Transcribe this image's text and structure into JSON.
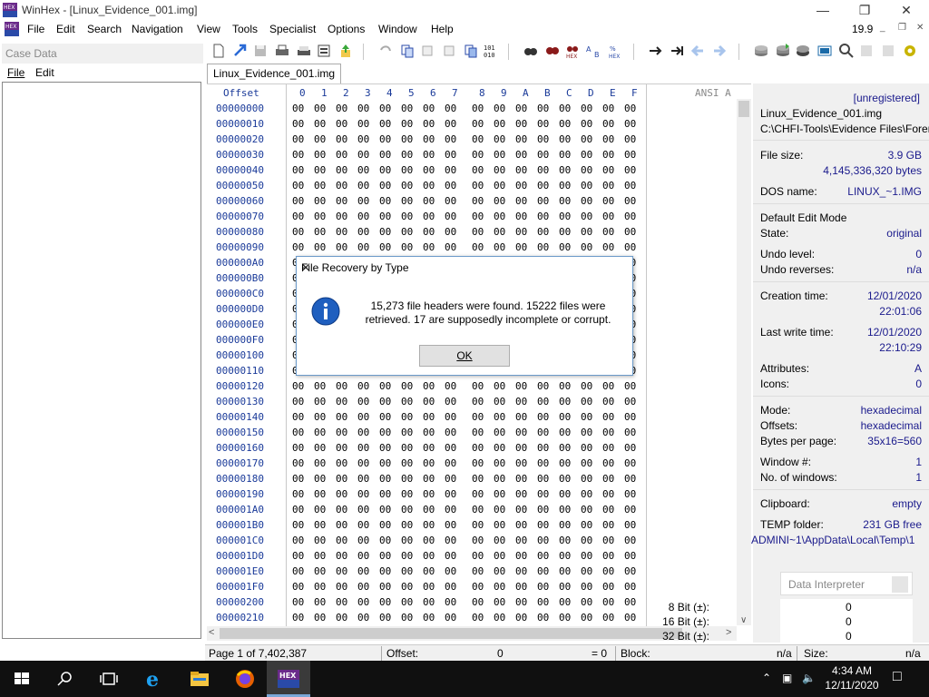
{
  "window": {
    "title": "WinHex - [Linux_Evidence_001.img]",
    "version": "19.9"
  },
  "menu": [
    "File",
    "Edit",
    "Search",
    "Navigation",
    "View",
    "Tools",
    "Specialist",
    "Options",
    "Window",
    "Help"
  ],
  "case_pane": {
    "header": "Case Data",
    "menu_file": "File",
    "menu_edit": "Edit"
  },
  "tab": {
    "label": "Linux_Evidence_001.img"
  },
  "hex": {
    "offset_header": "Offset",
    "column_headers": [
      "0",
      "1",
      "2",
      "3",
      "4",
      "5",
      "6",
      "7",
      "8",
      "9",
      "A",
      "B",
      "C",
      "D",
      "E",
      "F"
    ],
    "ansi_header": "ANSI A",
    "byte_value": "00",
    "offsets": [
      "00000000",
      "00000010",
      "00000020",
      "00000030",
      "00000040",
      "00000050",
      "00000060",
      "00000070",
      "00000080",
      "00000090",
      "000000A0",
      "000000B0",
      "000000C0",
      "000000D0",
      "000000E0",
      "000000F0",
      "00000100",
      "00000110",
      "00000120",
      "00000130",
      "00000140",
      "00000150",
      "00000160",
      "00000170",
      "00000180",
      "00000190",
      "000001A0",
      "000001B0",
      "000001C0",
      "000001D0",
      "000001E0",
      "000001F0",
      "00000200",
      "00000210"
    ]
  },
  "info": {
    "unregistered": "[unregistered]",
    "filename": "Linux_Evidence_001.img",
    "path": "C:\\CHFI-Tools\\Evidence Files\\Forer",
    "file_size_label": "File size:",
    "file_size": "3.9 GB",
    "file_size_bytes": "4,145,336,320 bytes",
    "dos_name_label": "DOS name:",
    "dos_name": "LINUX_~1.IMG",
    "edit_mode": "Default Edit Mode",
    "state_label": "State:",
    "state": "original",
    "undo_level_label": "Undo level:",
    "undo_level": "0",
    "undo_reverses_label": "Undo reverses:",
    "undo_reverses": "n/a",
    "creation_label": "Creation time:",
    "creation_date": "12/01/2020",
    "creation_time": "22:01:06",
    "lastwrite_label": "Last write time:",
    "lastwrite_date": "12/01/2020",
    "lastwrite_time": "22:10:29",
    "attributes_label": "Attributes:",
    "attributes": "A",
    "icons_label": "Icons:",
    "icons": "0",
    "mode_label": "Mode:",
    "mode": "hexadecimal",
    "offsets_label": "Offsets:",
    "offsets": "hexadecimal",
    "bpp_label": "Bytes per page:",
    "bpp": "35x16=560",
    "window_no_label": "Window #:",
    "window_no": "1",
    "num_windows_label": "No. of windows:",
    "num_windows": "1",
    "clipboard_label": "Clipboard:",
    "clipboard": "empty",
    "temp_label": "TEMP folder:",
    "temp_free": "231 GB free",
    "temp_path": "ADMINI~1\\AppData\\Local\\Temp\\1",
    "data_interpreter": "Data Interpreter",
    "di_8": "8 Bit (±):",
    "di_8_val": "0",
    "di_16": "16 Bit (±):",
    "di_16_val": "0",
    "di_32": "32 Bit (±):",
    "di_32_val": "0"
  },
  "status": {
    "page": "Page 1 of 7,402,387",
    "offset_label": "Offset:",
    "offset_val": "0",
    "eq": "= 0",
    "block_label": "Block:",
    "block_val": "n/a",
    "size_label": "Size:",
    "size_val": "n/a"
  },
  "dialog": {
    "title": "File Recovery by Type",
    "message": "15,273 file headers were found. 15222 files were retrieved. 17 are supposedly incomplete or corrupt.",
    "ok": "OK"
  },
  "taskbar": {
    "time": "4:34 AM",
    "date": "12/11/2020"
  }
}
